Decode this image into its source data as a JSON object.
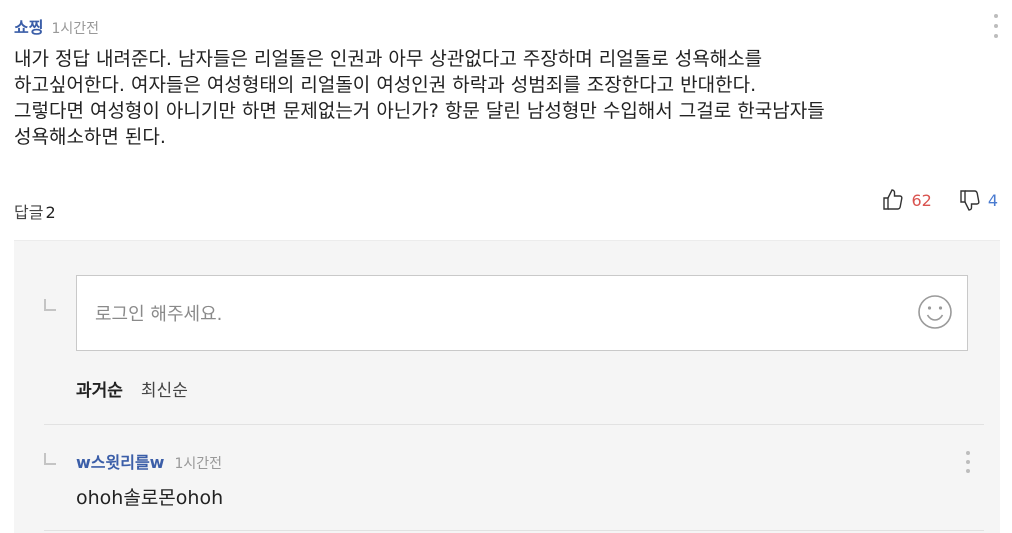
{
  "comment": {
    "author": "쇼찡",
    "time": "1시간전",
    "lines": [
      "내가 정답 내려준다. 남자들은 리얼돌은 인권과 아무 상관없다고 주장하며 리얼돌로 성욕해소를",
      "하고싶어한다. 여자들은 여성형태의 리얼돌이 여성인권 하락과 성범죄를 조장한다고 반대한다.",
      "그렇다면 여성형이 아니기만 하면 문제없는거 아닌가? 항문 달린 남성형만 수입해서 그걸로 한국남자들",
      "성욕해소하면 된다."
    ],
    "reply_label": "답글",
    "reply_count": "2",
    "likes": "62",
    "dislikes": "4",
    "more_icon": "more-vertical-icon"
  },
  "reply_input": {
    "placeholder": "로그인 해주세요.",
    "emoji_icon": "smiley-icon"
  },
  "sort": {
    "oldest": "과거순",
    "newest": "최신순"
  },
  "replies": [
    {
      "author": "w스윗리를w",
      "time": "1시간전",
      "text": "ohoh솔로몬ohoh"
    }
  ],
  "colors": {
    "author": "#3b5ea8",
    "likes": "#d9534f",
    "dislikes": "#4a7bd0",
    "panel_bg": "#f5f5f5"
  }
}
